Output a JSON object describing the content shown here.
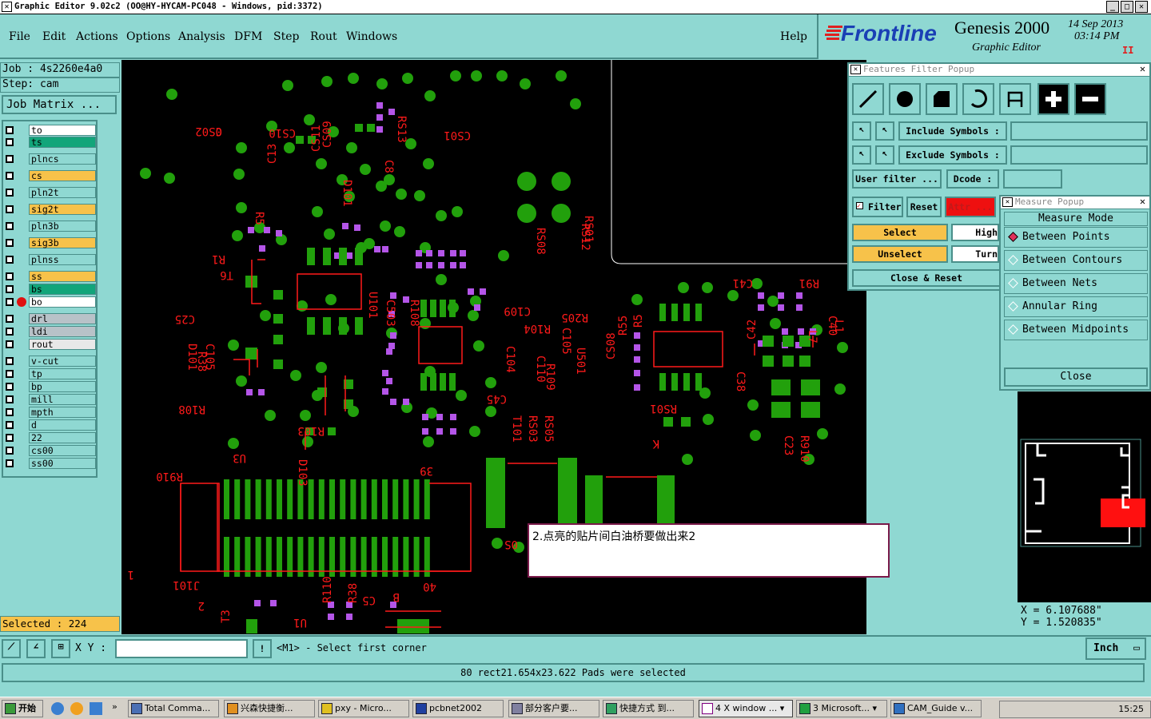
{
  "window": {
    "title": "Graphic Editor 9.02c2 (OO@HY-HYCAM-PC048 - Windows, pid:3372)",
    "minimize": "_",
    "maximize": "□",
    "close": "✕"
  },
  "menu": [
    "File",
    "Edit",
    "Actions",
    "Options",
    "Analysis",
    "DFM",
    "Step",
    "Rout",
    "Windows"
  ],
  "help": "Help",
  "brand": {
    "logo": "Frontline",
    "product": "Genesis 2000",
    "subtitle": "Graphic Editor",
    "date": "14 Sep 2013",
    "time": "03:14 PM",
    "pause": "II"
  },
  "job": {
    "job_label": "Job : 4s2260e4a0",
    "step_label": "Step: cam",
    "matrix_button": "Job Matrix ..."
  },
  "layers": [
    {
      "name": "to",
      "color": "#ffffff"
    },
    {
      "name": "ts",
      "color": "#12a57a"
    },
    {
      "name": "plncs",
      "color": "#8fd8d2"
    },
    {
      "name": "cs",
      "color": "#f7c24a"
    },
    {
      "name": "pln2t",
      "color": "#8fd8d2"
    },
    {
      "name": "sig2t",
      "color": "#f7c24a"
    },
    {
      "name": "pln3b",
      "color": "#8fd8d2"
    },
    {
      "name": "sig3b",
      "color": "#f7c24a"
    },
    {
      "name": "plnss",
      "color": "#8fd8d2"
    },
    {
      "name": "ss",
      "color": "#f7c24a"
    },
    {
      "name": "bs",
      "color": "#12a57a"
    },
    {
      "name": "bo",
      "color": "#ffffff"
    },
    {
      "name": "drl",
      "color": "#b8c2c8"
    },
    {
      "name": "ldi",
      "color": "#b8c2c8"
    },
    {
      "name": "rout",
      "color": "#e8e8e8"
    },
    {
      "name": "v-cut",
      "color": "#8fd8d2"
    },
    {
      "name": "tp",
      "color": "#8fd8d2"
    },
    {
      "name": "bp",
      "color": "#8fd8d2"
    },
    {
      "name": "mill",
      "color": "#8fd8d2"
    },
    {
      "name": "mpth",
      "color": "#8fd8d2"
    },
    {
      "name": "d",
      "color": "#8fd8d2"
    },
    {
      "name": "22",
      "color": "#8fd8d2"
    },
    {
      "name": "cs00",
      "color": "#8fd8d2"
    },
    {
      "name": "ss00",
      "color": "#8fd8d2"
    }
  ],
  "selected_label": "Selected : 224",
  "filter_popup": {
    "title": "Features Filter Popup",
    "include_label": "Include Symbols :",
    "exclude_label": "Exclude Symbols :",
    "user_filter": "User filter ...",
    "dcode": "Dcode :",
    "filter": "Filter",
    "reset": "Reset",
    "attr": "Attr ...",
    "select": "Select",
    "unselect": "Unselect",
    "highlight": "High",
    "turn": "Turn",
    "close_reset": "Close & Reset"
  },
  "measure_popup": {
    "title": "Measure Popup",
    "mode": "Measure Mode",
    "options": [
      "Between Points",
      "Between Contours",
      "Between Nets",
      "Annular Ring",
      "Between Midpoints"
    ],
    "close": "Close"
  },
  "coords": {
    "x": "X  =  6.107688\"",
    "y": "Y  =  1.520835\""
  },
  "command": {
    "xy_label": "X Y :",
    "prompt": "<M1> - Select first corner",
    "units": "Inch",
    "bang": "!"
  },
  "status": "80 rect21.654x23.622 Pads were selected",
  "note": "2.点亮的贴片间白油桥要做出来2",
  "board_labels": [
    {
      "t": "CS02"
    },
    {
      "t": "CS10"
    },
    {
      "t": "RS13"
    },
    {
      "t": "CS01"
    },
    {
      "t": "C13"
    },
    {
      "t": "CS11"
    },
    {
      "t": "CS09"
    },
    {
      "t": "D101"
    },
    {
      "t": "C8"
    },
    {
      "t": "R5"
    },
    {
      "t": "RS08"
    },
    {
      "t": "RS12"
    },
    {
      "t": "RS01"
    },
    {
      "t": "R1"
    },
    {
      "t": "T6"
    },
    {
      "t": "U101"
    },
    {
      "t": "C503"
    },
    {
      "t": "C41"
    },
    {
      "t": "R91"
    },
    {
      "t": "C25"
    },
    {
      "t": "R108"
    },
    {
      "t": "C109"
    },
    {
      "t": "R205"
    },
    {
      "t": "R104"
    },
    {
      "t": "C105"
    },
    {
      "t": "R38"
    },
    {
      "t": "C40"
    },
    {
      "t": "D101"
    },
    {
      "t": "C105"
    },
    {
      "t": "C104"
    },
    {
      "t": "C110"
    },
    {
      "t": "R109"
    },
    {
      "t": "U501"
    },
    {
      "t": "CS08"
    },
    {
      "t": "R55"
    },
    {
      "t": "R5"
    },
    {
      "t": "C38"
    },
    {
      "t": "C42"
    },
    {
      "t": "L7"
    },
    {
      "t": "L1"
    },
    {
      "t": "C45"
    },
    {
      "t": "R108"
    },
    {
      "t": "R103"
    },
    {
      "t": "T101"
    },
    {
      "t": "RS03"
    },
    {
      "t": "RS05"
    },
    {
      "t": "RS01"
    },
    {
      "t": "U3"
    },
    {
      "t": "D103"
    },
    {
      "t": "K"
    },
    {
      "t": "C23"
    },
    {
      "t": "R910"
    },
    {
      "t": "R910"
    },
    {
      "t": "39"
    },
    {
      "t": "1"
    },
    {
      "t": "J101"
    },
    {
      "t": "40"
    },
    {
      "t": "2"
    },
    {
      "t": "R110"
    },
    {
      "t": "R38"
    },
    {
      "t": "C5"
    },
    {
      "t": "B"
    },
    {
      "t": "U1"
    },
    {
      "t": "T3"
    },
    {
      "t": "0S"
    },
    {
      "t": "0"
    }
  ]
}
